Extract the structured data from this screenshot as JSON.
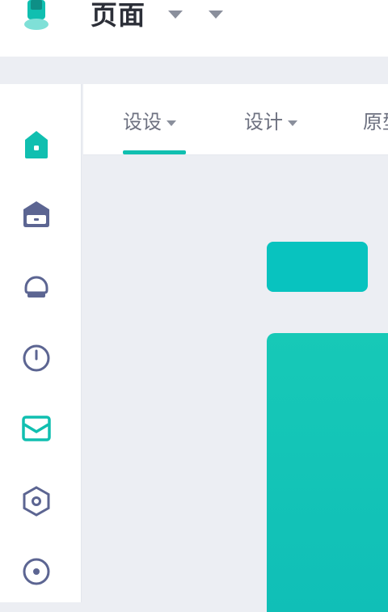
{
  "header": {
    "title": "页面",
    "colors": {
      "accent": "#10bfb0",
      "text": "#2c2f38"
    }
  },
  "tabs": [
    {
      "label": "设设"
    },
    {
      "label": "设计"
    },
    {
      "label": "原型"
    }
  ],
  "sidebar": {
    "items": [
      {
        "icon": "home-icon",
        "active": true
      },
      {
        "icon": "inbox-icon",
        "active": false
      },
      {
        "icon": "profile-icon",
        "active": false
      },
      {
        "icon": "clock-icon",
        "active": false
      },
      {
        "icon": "mail-icon",
        "active": true
      },
      {
        "icon": "settings-hexagon-icon",
        "active": false
      },
      {
        "icon": "target-icon",
        "active": false
      }
    ]
  },
  "main": {
    "primary_button_color": "#08c3bf",
    "panel_color": "#14c4b6"
  }
}
